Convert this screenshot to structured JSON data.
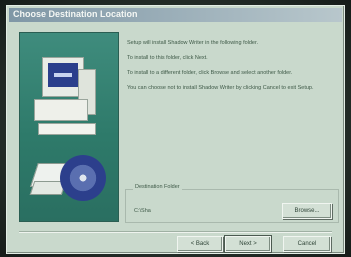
{
  "window": {
    "title": "Choose Destination Location"
  },
  "content": {
    "paragraphs": [
      "Setup will install Shadow Writer in the following folder.",
      "To install to this folder, click Next.",
      "To install to a different folder, click Browse and select another folder.",
      "You can choose not to install Shadow Writer by clicking Cancel to exit Setup."
    ]
  },
  "destination": {
    "group_label": "Destination Folder",
    "path": "C:\\Sha"
  },
  "buttons": {
    "browse": "Browse...",
    "back": "< Back",
    "next": "Next >",
    "cancel": "Cancel"
  },
  "colors": {
    "panel": "#3f8c7d",
    "dialog_bg": "#c9d9cc",
    "text": "#3f5a48"
  },
  "icons": {
    "computer": "computer-icon",
    "disc": "disc-icon"
  }
}
